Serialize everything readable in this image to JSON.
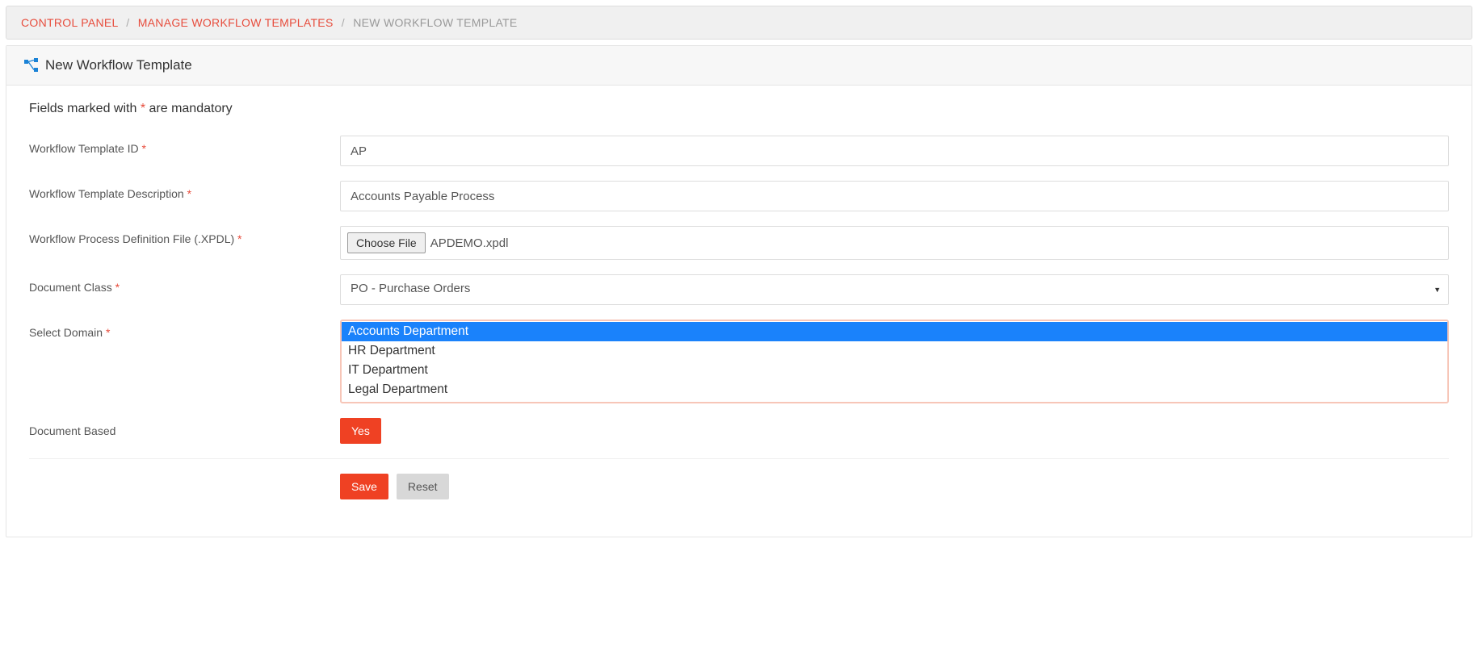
{
  "breadcrumb": {
    "items": [
      "CONTROL PANEL",
      "MANAGE WORKFLOW TEMPLATES"
    ],
    "current": "NEW WORKFLOW TEMPLATE"
  },
  "panel": {
    "title": "New Workflow Template"
  },
  "mandatory_note": {
    "prefix": "Fields marked with ",
    "asterisk": "*",
    "suffix": " are mandatory"
  },
  "form": {
    "template_id": {
      "label": "Workflow Template ID",
      "value": "AP"
    },
    "template_desc": {
      "label": "Workflow Template Description",
      "value": "Accounts Payable Process"
    },
    "xpdl": {
      "label": "Workflow Process Definition File (.XPDL)",
      "choose_label": "Choose File",
      "filename": "APDEMO.xpdl"
    },
    "doc_class": {
      "label": "Document Class",
      "value": "PO - Purchase Orders"
    },
    "domain": {
      "label": "Select Domain",
      "options": [
        "Accounts Department",
        "HR Department",
        "IT Department",
        "Legal Department"
      ],
      "selected_index": 0
    },
    "doc_based": {
      "label": "Document Based",
      "value": "Yes"
    }
  },
  "actions": {
    "save": "Save",
    "reset": "Reset"
  }
}
